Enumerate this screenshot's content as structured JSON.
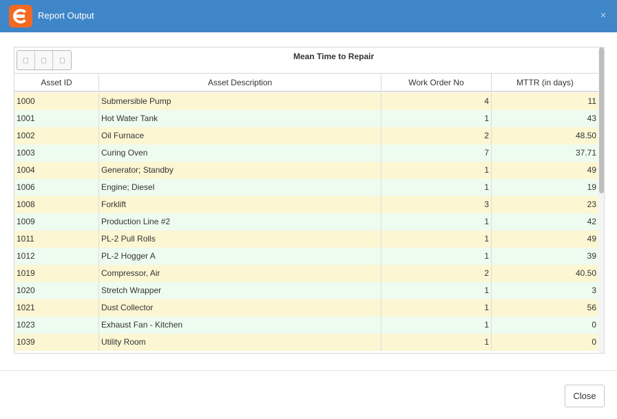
{
  "window": {
    "title": "Report Output"
  },
  "report": {
    "title": "Mean Time to Repair",
    "columns": [
      "Asset ID",
      "Asset Description",
      "Work Order No",
      "MTTR (in days)"
    ],
    "rows": [
      {
        "id": "1000",
        "description": "Submersible Pump",
        "work_orders": "4",
        "mttr": "11"
      },
      {
        "id": "1001",
        "description": "Hot Water Tank",
        "work_orders": "1",
        "mttr": "43"
      },
      {
        "id": "1002",
        "description": "Oil Furnace",
        "work_orders": "2",
        "mttr": "48.50"
      },
      {
        "id": "1003",
        "description": "Curing Oven",
        "work_orders": "7",
        "mttr": "37.71"
      },
      {
        "id": "1004",
        "description": "Generator; Standby",
        "work_orders": "1",
        "mttr": "49"
      },
      {
        "id": "1006",
        "description": "Engine; Diesel",
        "work_orders": "1",
        "mttr": "19"
      },
      {
        "id": "1008",
        "description": "Forklift",
        "work_orders": "3",
        "mttr": "23"
      },
      {
        "id": "1009",
        "description": "Production Line #2",
        "work_orders": "1",
        "mttr": "42"
      },
      {
        "id": "1011",
        "description": "PL-2 Pull Rolls",
        "work_orders": "1",
        "mttr": "49"
      },
      {
        "id": "1012",
        "description": "PL-2 Hogger A",
        "work_orders": "1",
        "mttr": "39"
      },
      {
        "id": "1019",
        "description": "Compressor, Air",
        "work_orders": "2",
        "mttr": "40.50"
      },
      {
        "id": "1020",
        "description": "Stretch Wrapper",
        "work_orders": "1",
        "mttr": "3"
      },
      {
        "id": "1021",
        "description": "Dust Collector",
        "work_orders": "1",
        "mttr": "56"
      },
      {
        "id": "1023",
        "description": "Exhaust Fan - Kitchen",
        "work_orders": "1",
        "mttr": "0"
      },
      {
        "id": "1039",
        "description": "Utility Room",
        "work_orders": "1",
        "mttr": "0"
      }
    ]
  },
  "footer": {
    "close_label": "Close"
  },
  "icons": {
    "dialog_close": "×"
  },
  "colors": {
    "titlebar": "#3f86c9",
    "logo": "#f26a21",
    "row_odd": "#fcf6d3",
    "row_even": "#eefbef"
  }
}
